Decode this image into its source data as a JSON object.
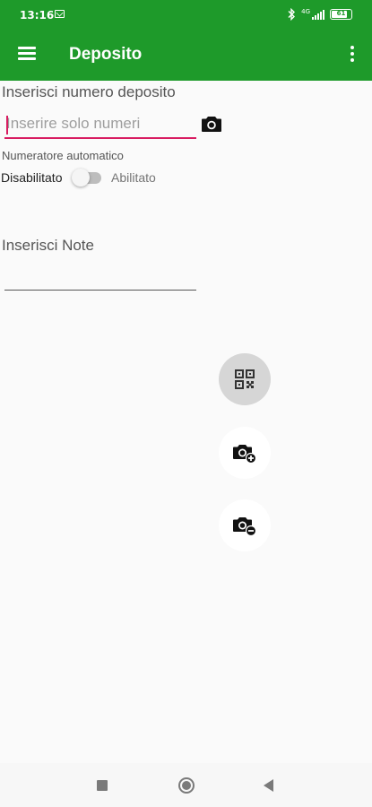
{
  "status_bar": {
    "time": "13:16",
    "network": "4G",
    "battery": "61"
  },
  "app_bar": {
    "title": "Deposito",
    "color": "#1e9a2a"
  },
  "form": {
    "deposit_label": "Inserisci numero deposito",
    "deposit_placeholder": "Inserire solo numeri",
    "deposit_value": "",
    "auto_numerator_label": "Numeratore automatico",
    "switch_off_label": "Disabilitato",
    "switch_on_label": "Abilitato",
    "switch_enabled": false,
    "note_label": "Inserisci Note",
    "note_value": ""
  },
  "fabs": [
    {
      "icon": "qr-code-icon"
    },
    {
      "icon": "camera-add-icon"
    },
    {
      "icon": "camera-remove-icon"
    }
  ],
  "icons": {
    "menu": "menu-icon",
    "overflow": "more-vert-icon",
    "camera": "camera-icon"
  },
  "colors": {
    "accent": "#d81b60",
    "primary": "#1e9a2a"
  }
}
